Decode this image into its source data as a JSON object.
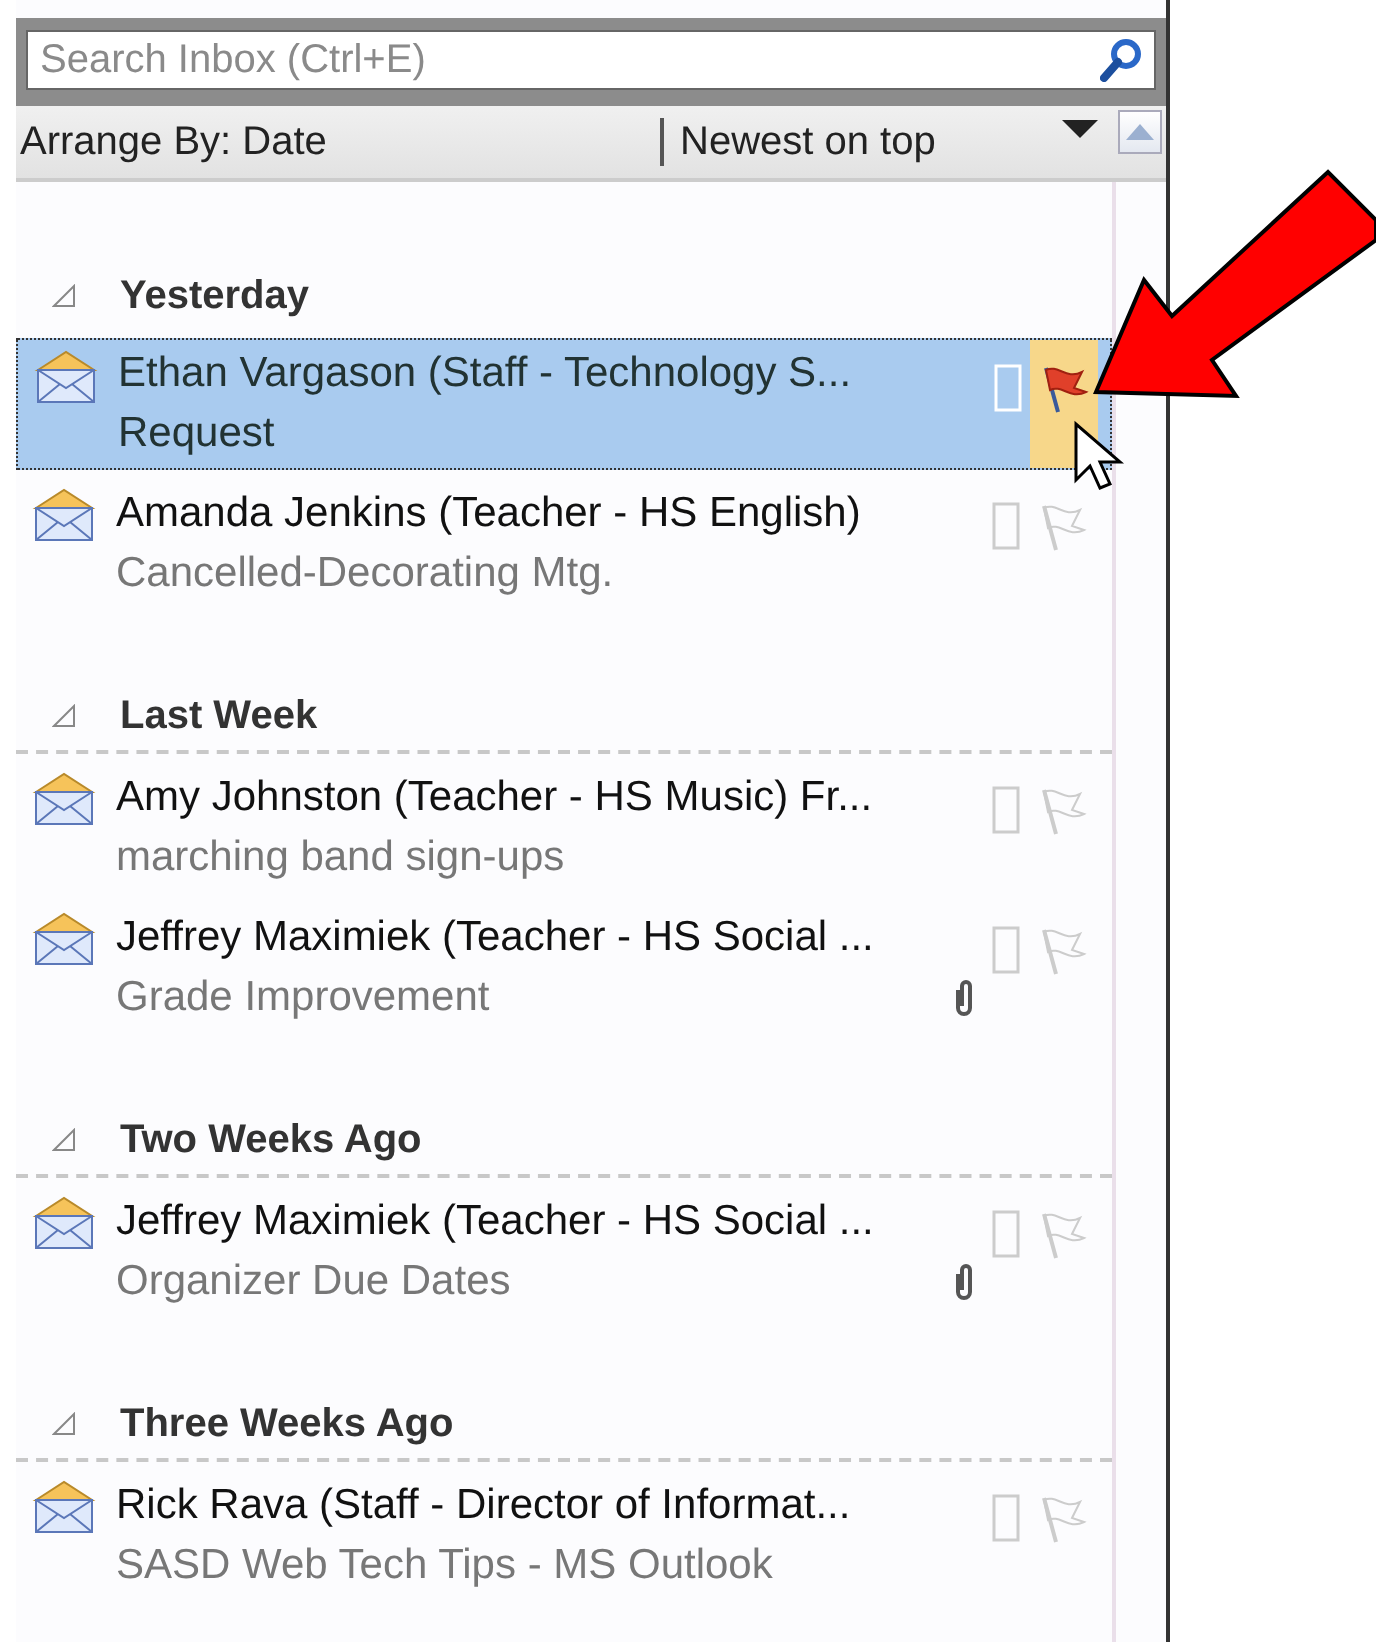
{
  "search": {
    "placeholder": "Search Inbox (Ctrl+E)"
  },
  "arrange": {
    "by": "Arrange By: Date",
    "order": "Newest on top"
  },
  "groups": [
    {
      "title": "Yesterday",
      "expanded": true,
      "messages": [
        {
          "sender": "Ethan Vargason (Staff - Technology S...",
          "subject": "Request",
          "selected": true,
          "flagged": true,
          "attachment": false
        },
        {
          "sender": "Amanda Jenkins (Teacher - HS English)",
          "subject": "Cancelled-Decorating Mtg.",
          "selected": false,
          "flagged": false,
          "attachment": false
        }
      ]
    },
    {
      "title": "Last Week",
      "expanded": true,
      "messages": [
        {
          "sender": "Amy Johnston (Teacher - HS Music) Fr...",
          "subject": "marching band sign-ups",
          "selected": false,
          "flagged": false,
          "attachment": false
        },
        {
          "sender": "Jeffrey Maximiek (Teacher - HS Social ...",
          "subject": "Grade Improvement",
          "selected": false,
          "flagged": false,
          "attachment": true
        }
      ]
    },
    {
      "title": "Two Weeks Ago",
      "expanded": true,
      "messages": [
        {
          "sender": "Jeffrey Maximiek (Teacher - HS Social ...",
          "subject": "Organizer Due Dates",
          "selected": false,
          "flagged": false,
          "attachment": true
        }
      ]
    },
    {
      "title": "Three Weeks Ago",
      "expanded": true,
      "messages": [
        {
          "sender": "Rick Rava (Staff - Director of Informat...",
          "subject": "SASD Web Tech Tips - MS Outlook",
          "selected": false,
          "flagged": false,
          "attachment": false
        }
      ]
    }
  ]
}
